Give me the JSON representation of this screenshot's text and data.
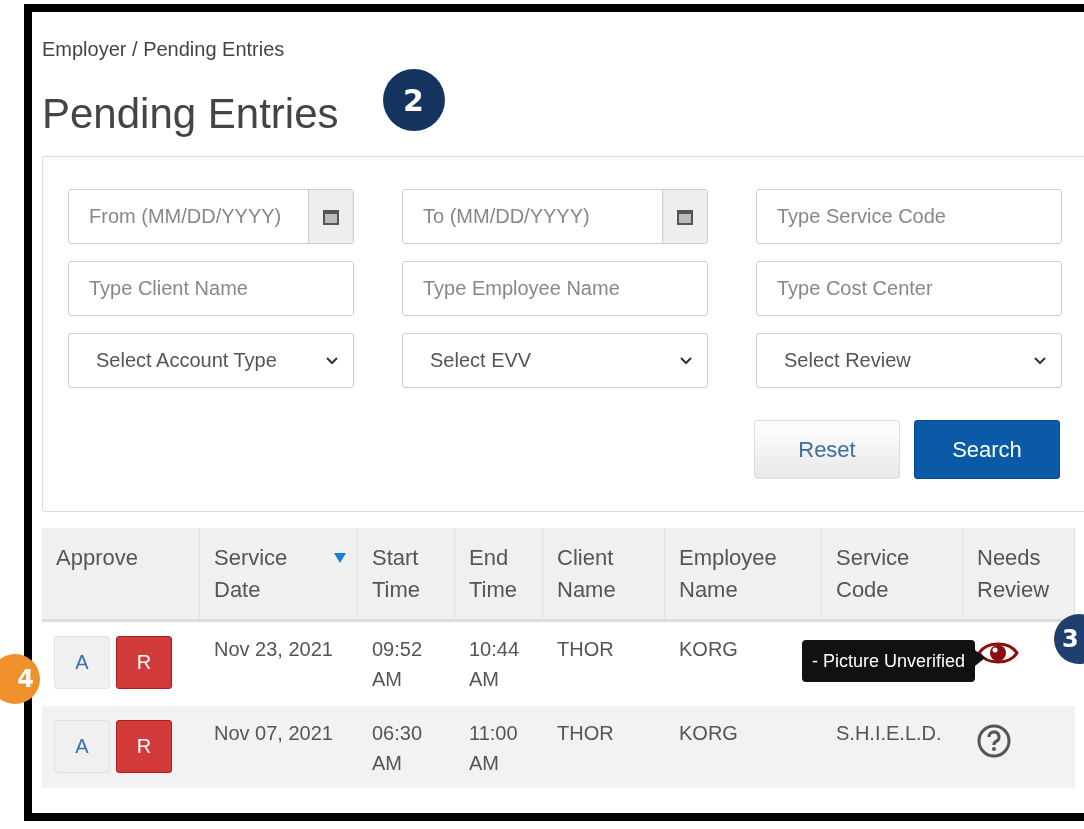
{
  "breadcrumb": "Employer / Pending Entries",
  "title": "Pending Entries",
  "callouts": [
    {
      "label": "2",
      "color": "#14335f",
      "kind": "title"
    },
    {
      "label": "3",
      "color": "#1f3f6e",
      "kind": "right"
    },
    {
      "label": "4",
      "color": "#f0902a",
      "kind": "left"
    }
  ],
  "filters": [
    {
      "kind": "date",
      "placeholder": "From (MM/DD/YYYY)"
    },
    {
      "kind": "date",
      "placeholder": "To (MM/DD/YYYY)"
    },
    {
      "kind": "text",
      "placeholder": "Type Service Code"
    },
    {
      "kind": "text",
      "placeholder": "Type Client Name"
    },
    {
      "kind": "text",
      "placeholder": "Type Employee Name"
    },
    {
      "kind": "text",
      "placeholder": "Type Cost Center"
    },
    {
      "kind": "select",
      "value": "Select Account Type"
    },
    {
      "kind": "select",
      "value": "Select EVV"
    },
    {
      "kind": "select",
      "value": "Select Review"
    }
  ],
  "buttons": [
    {
      "label": "Reset",
      "kind": "secondary"
    },
    {
      "label": "Search",
      "kind": "primary"
    }
  ],
  "table": {
    "columns": [
      {
        "label": "Approve",
        "sorted": false
      },
      {
        "label": "Service Date",
        "sorted": true
      },
      {
        "label": "Start Time",
        "sorted": false
      },
      {
        "label": "End Time",
        "sorted": false
      },
      {
        "label": "Client Name",
        "sorted": false
      },
      {
        "label": "Employee Name",
        "sorted": false
      },
      {
        "label": "Service Code",
        "sorted": false
      },
      {
        "label": "Needs Review",
        "sorted": false
      }
    ],
    "rows": [
      {
        "approve": "A",
        "reject": "R",
        "date": "Nov 23, 2021",
        "start": "09:52 AM",
        "end": "10:44 AM",
        "client": "THOR",
        "employee": "KORG",
        "tooltip": "- Picture Unverified",
        "kind": "eye"
      },
      {
        "approve": "A",
        "reject": "R",
        "date": "Nov 07, 2021",
        "start": "06:30 AM",
        "end": "11:00 AM",
        "client": "THOR",
        "employee": "KORG",
        "service_code": "S.H.I.E.L.D.",
        "kind": "question"
      }
    ]
  }
}
